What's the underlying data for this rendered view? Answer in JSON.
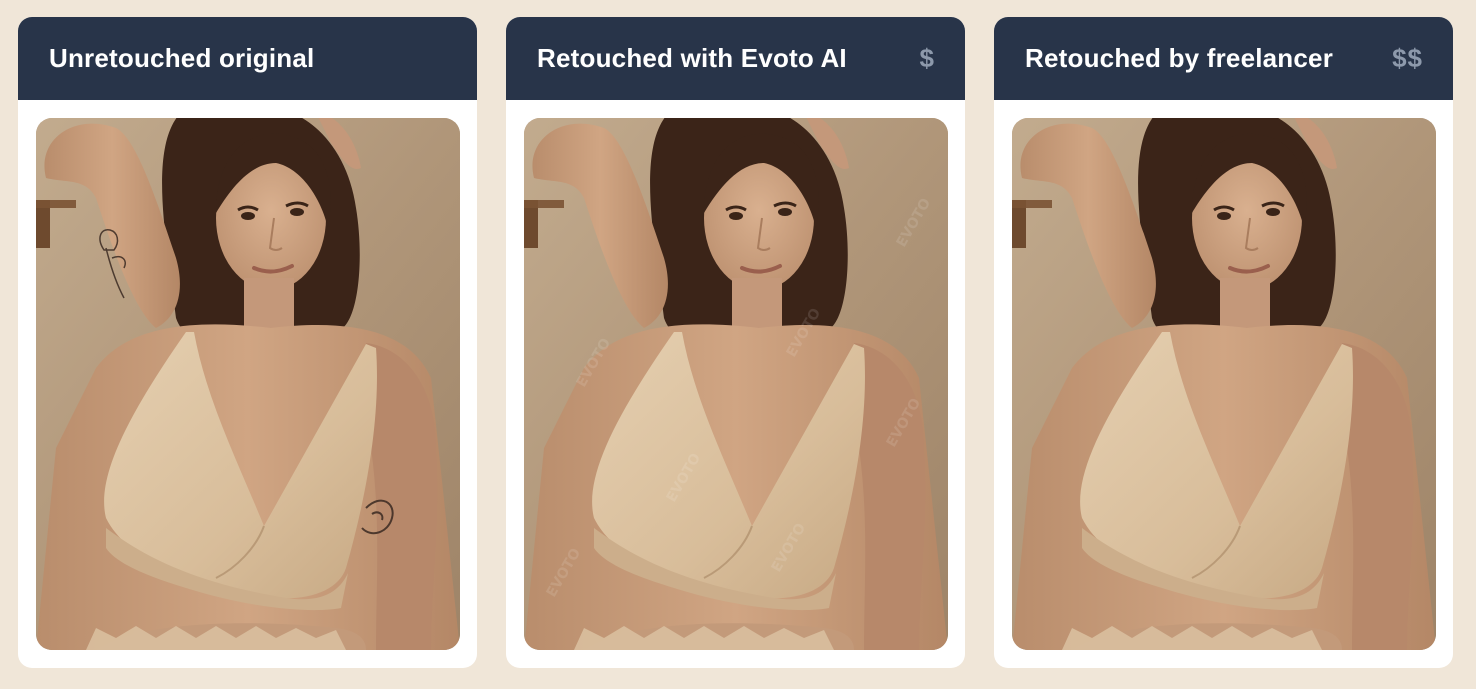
{
  "cards": [
    {
      "title": "Unretouched original",
      "price": "",
      "image": "portrait-photo-original"
    },
    {
      "title": "Retouched with Evoto AI",
      "price": "$",
      "image": "portrait-photo-evoto-ai",
      "watermark": "EVOTO"
    },
    {
      "title": "Retouched by freelancer",
      "price": "$$",
      "image": "portrait-photo-freelancer"
    }
  ],
  "colors": {
    "page_background": "#f0e6d8",
    "header_background": "#283449",
    "header_text": "#ffffff",
    "price_text": "#8d99ab",
    "card_background": "#ffffff"
  }
}
